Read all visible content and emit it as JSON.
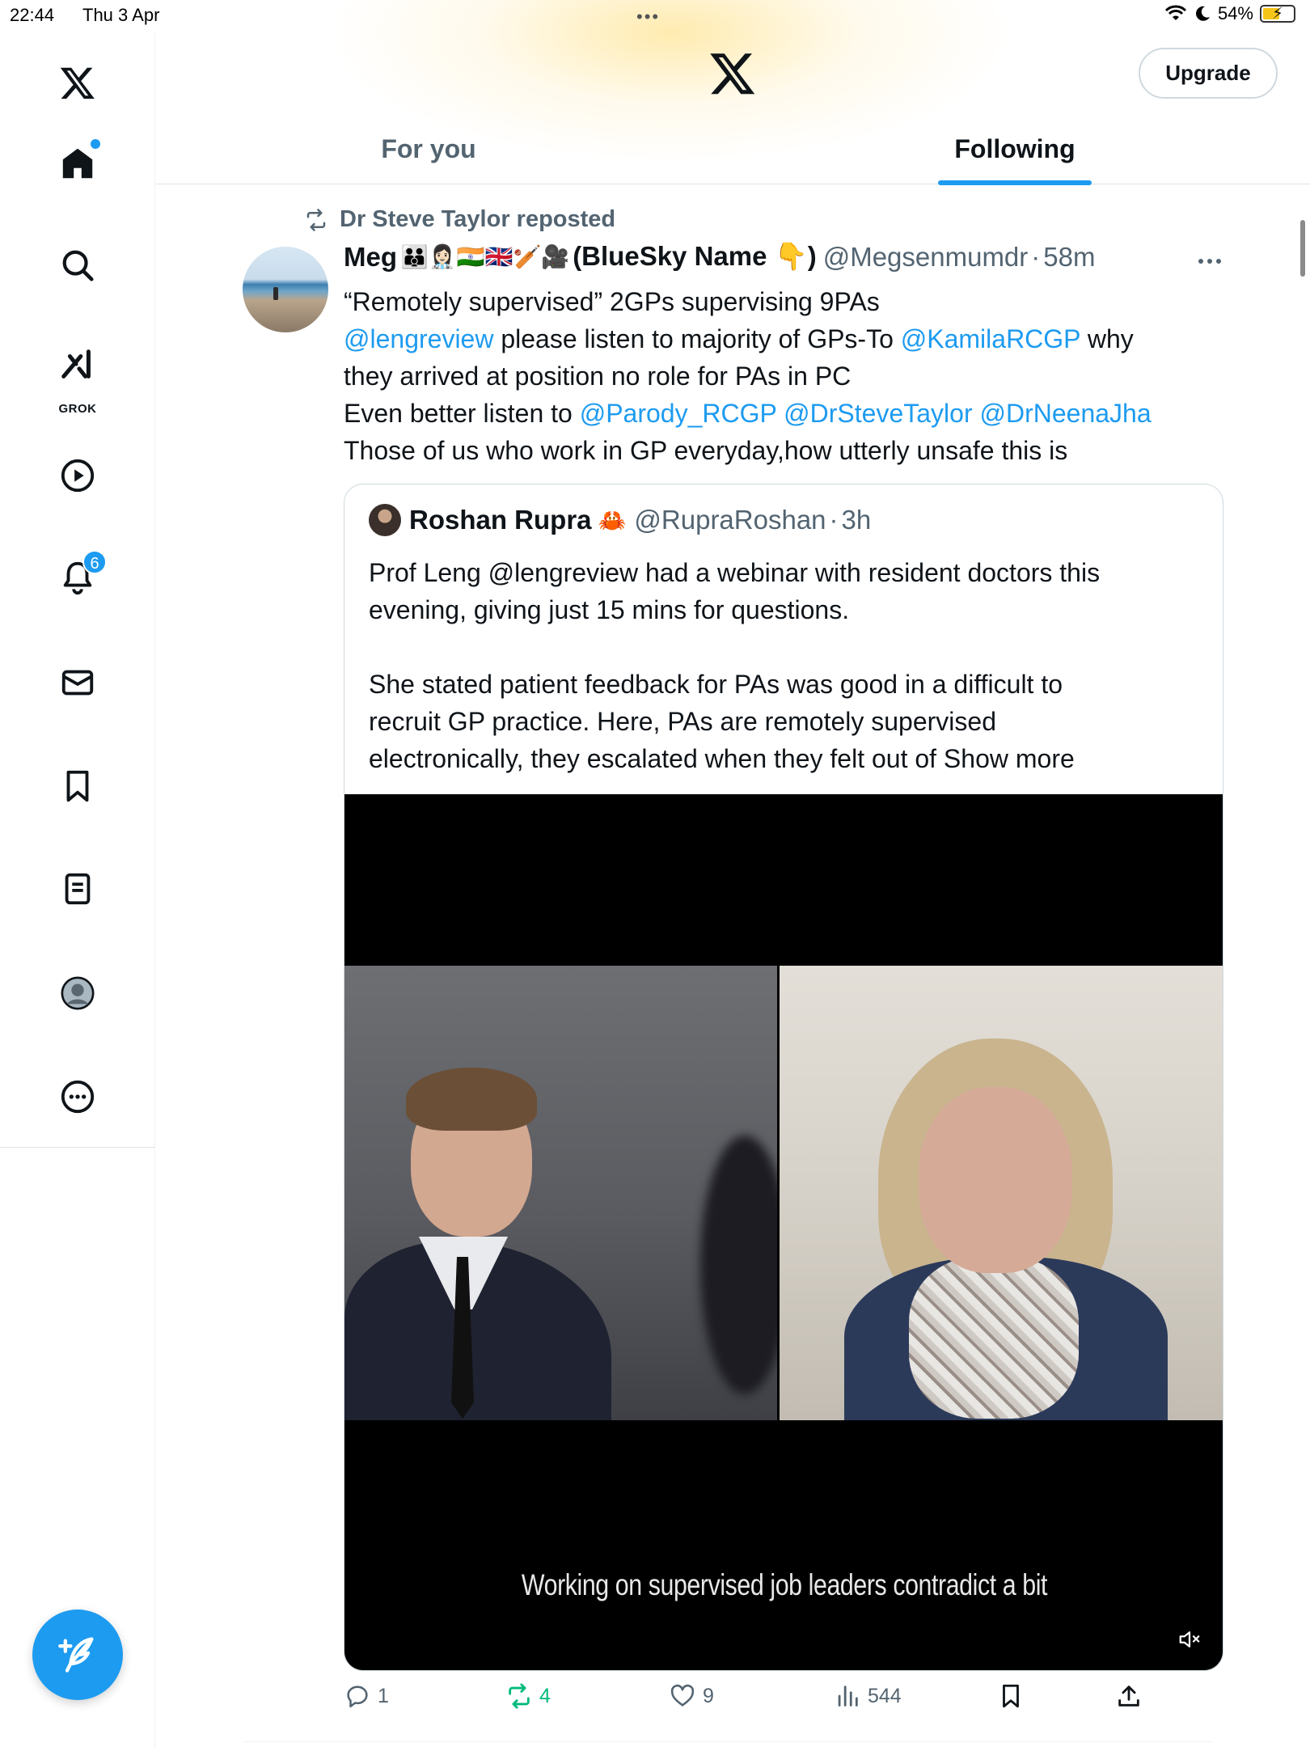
{
  "status_bar": {
    "time": "22:44",
    "date": "Thu 3 Apr",
    "dots": "•••",
    "battery": "54%"
  },
  "sidebar": {
    "items": [
      {
        "name": "home",
        "icon": "home-icon"
      },
      {
        "name": "search",
        "icon": "search-icon"
      },
      {
        "name": "grok",
        "icon": "grok-icon",
        "label": "GROK"
      },
      {
        "name": "video",
        "icon": "play-icon"
      },
      {
        "name": "notifications",
        "icon": "bell-icon",
        "badge": "6"
      },
      {
        "name": "messages",
        "icon": "mail-icon"
      },
      {
        "name": "bookmarks",
        "icon": "bookmark-icon"
      },
      {
        "name": "lists",
        "icon": "list-icon"
      },
      {
        "name": "profile",
        "icon": "avatar-icon"
      },
      {
        "name": "more",
        "icon": "more-circle-icon"
      }
    ],
    "compose_icon": "compose-icon"
  },
  "header": {
    "upgrade_label": "Upgrade",
    "tabs": [
      {
        "label": "For you",
        "active": false
      },
      {
        "label": "Following",
        "active": true
      }
    ]
  },
  "tweet": {
    "repost_label": "Dr Steve Taylor reposted",
    "author_name": "Meg",
    "author_emojis": "👪👩🏻‍⚕️🇮🇳🇬🇧🏏🎥",
    "author_suffix": "(BlueSky Name 👇)",
    "handle": "@Megsenmumdr",
    "sep": "·",
    "time": "58m",
    "line1": "“Remotely supervised” 2GPs supervising 9PAs",
    "line2_m1": "@lengreview",
    "line2_t1": " please listen to majority of GPs-To ",
    "line2_m2": "@KamilaRCGP",
    "line2_t2": " why",
    "line3": "they arrived at position no role for PAs in PC",
    "line4_t1": "Even better listen to ",
    "line4_m1": "@Parody_RCGP",
    "line4_m2": "@DrSteveTaylor",
    "line4_m3": "@DrNeenaJha",
    "line5": "Those of us who work in GP everyday,how utterly unsafe this is",
    "quote": {
      "name": "Roshan Rupra",
      "emoji": "🦀",
      "handle": "@RupraRoshan",
      "sep": "·",
      "time": "3h",
      "p1_l1": "Prof Leng @lengreview had a webinar with resident doctors this",
      "p1_l2": "evening, giving just 15 mins for questions.",
      "p2_l1": "She stated patient feedback for PAs was good in a difficult to",
      "p2_l2": "recruit GP practice. Here, PAs are remotely supervised",
      "p2_l3": "electronically, they escalated when they felt out of ",
      "show_more": "Show more",
      "video_subtitle": "Working on supervised job leaders contradict a bit"
    },
    "actions": {
      "replies": "1",
      "reposts": "4",
      "likes": "9",
      "views": "544"
    }
  },
  "colors": {
    "accent": "#1d9bf0",
    "repost_green": "#00ba7c",
    "secondary_text": "#536471"
  }
}
